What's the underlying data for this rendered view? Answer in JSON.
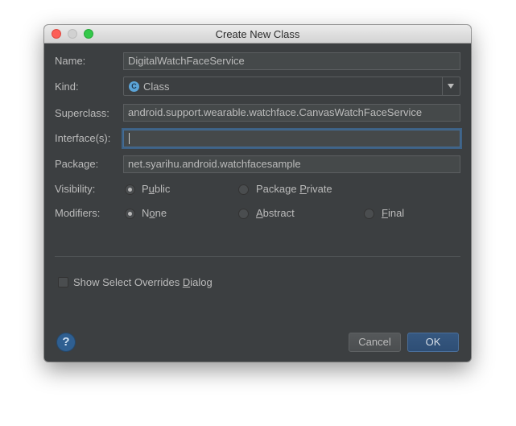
{
  "window": {
    "title": "Create New Class"
  },
  "form": {
    "name": {
      "label": "Name:",
      "value": "DigitalWatchFaceService"
    },
    "kind": {
      "label": "Kind:",
      "value": "Class",
      "icon": "C"
    },
    "superclass": {
      "label": "Superclass:",
      "value": "android.support.wearable.watchface.CanvasWatchFaceService"
    },
    "interfaces": {
      "label": "Interface(s):",
      "value": ""
    },
    "package": {
      "label": "Package:",
      "value": "net.syarihu.android.watchfacesample"
    },
    "visibility": {
      "label": "Visibility:",
      "public_a": "P",
      "public_u": "u",
      "public_b": "blic",
      "pkgprivate_a": "Package ",
      "pkgprivate_u": "P",
      "pkgprivate_b": "rivate",
      "selected": "Public"
    },
    "modifiers": {
      "label": "Modifiers:",
      "none_a": "N",
      "none_u": "o",
      "none_b": "ne",
      "abstract_u": "A",
      "abstract_b": "bstract",
      "final_u": "F",
      "final_b": "inal",
      "selected": "None"
    },
    "show_overrides": {
      "label_a": "Show Select Overrides ",
      "label_u": "D",
      "label_b": "ialog",
      "checked": false
    }
  },
  "buttons": {
    "help": "?",
    "cancel": "Cancel",
    "ok": "OK"
  },
  "colors": {
    "background": "#3c3f41",
    "field": "#45494a",
    "text": "#bbbbbb",
    "focus": "#3d6185",
    "ok_button": "#365880",
    "kind_icon": "#5ba4d8"
  }
}
